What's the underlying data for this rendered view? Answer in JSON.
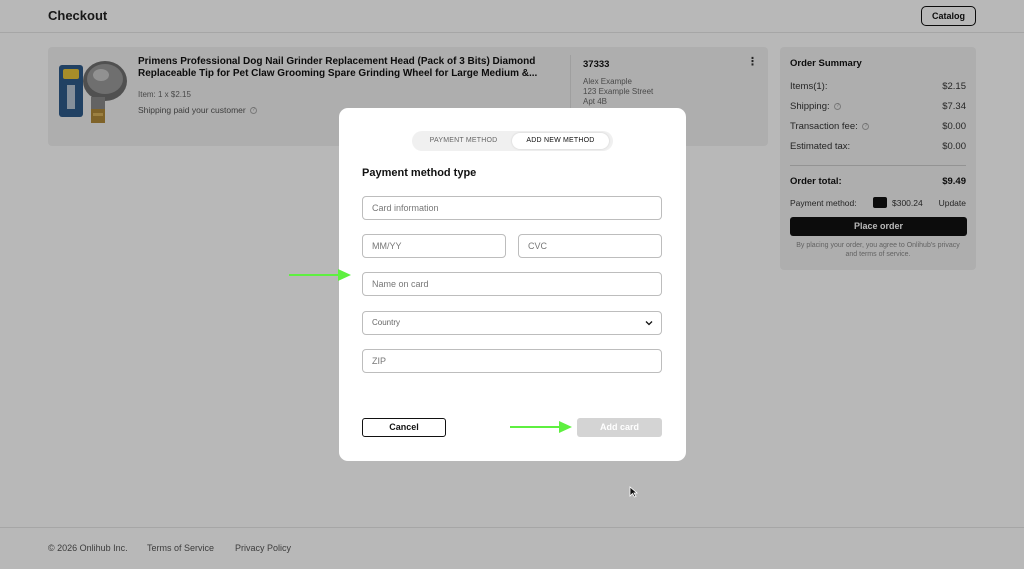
{
  "header": {
    "title": "Checkout",
    "catalog_label": "Catalog"
  },
  "product": {
    "title": "Primens Professional Dog Nail Grinder Replacement Head (Pack of 3 Bits) Diamond Replaceable Tip for Pet Claw Grooming Spare Grinding Wheel for Large Medium &...",
    "qty": "Item: 1 x $2.15",
    "shipping": "Shipping paid your customer",
    "order_number": "37333",
    "address": [
      "Alex Example",
      "123 Example Street",
      "Apt 4B"
    ]
  },
  "summary": {
    "title": "Order Summary",
    "rows": [
      {
        "label": "Items(1):",
        "value": "$2.15"
      },
      {
        "label": "Shipping:",
        "value": "$7.34"
      },
      {
        "label": "Transaction fee:",
        "value": "$0.00"
      },
      {
        "label": "Estimated tax:",
        "value": "$0.00"
      }
    ],
    "total_label": "Order total:",
    "total_value": "$9.49",
    "payment_label": "Payment method:",
    "wallet_amount": "$300.24",
    "update_label": "Update",
    "place_order_label": "Place order",
    "legal": "By placing your order, you agree to Onlihub's privacy and terms of service."
  },
  "footer": {
    "copyright": "© 2026 Onlihub Inc.",
    "terms": "Terms of Service",
    "privacy": "Privacy Policy"
  },
  "modal": {
    "tabs": [
      "PAYMENT METHOD",
      "ADD NEW METHOD"
    ],
    "active_tab": "ADD NEW METHOD",
    "title": "Payment method type",
    "fields": {
      "card_info_placeholder": "Card information",
      "expiry_placeholder": "MM/YY",
      "cvc_placeholder": "CVC",
      "name_placeholder": "Name on card",
      "country_label": "Country",
      "zip_placeholder": "ZIP"
    },
    "cancel_label": "Cancel",
    "add_card_label": "Add card"
  },
  "colors": {
    "accent_arrow": "#5ef040",
    "primary_button": "#111111",
    "disabled_button": "#d4d4d4"
  },
  "icons": [
    "product-image",
    "info-icon",
    "more-vertical-icon",
    "wallet-icon",
    "chevron-down-icon",
    "arrow-right-icon",
    "mouse-cursor-icon"
  ]
}
